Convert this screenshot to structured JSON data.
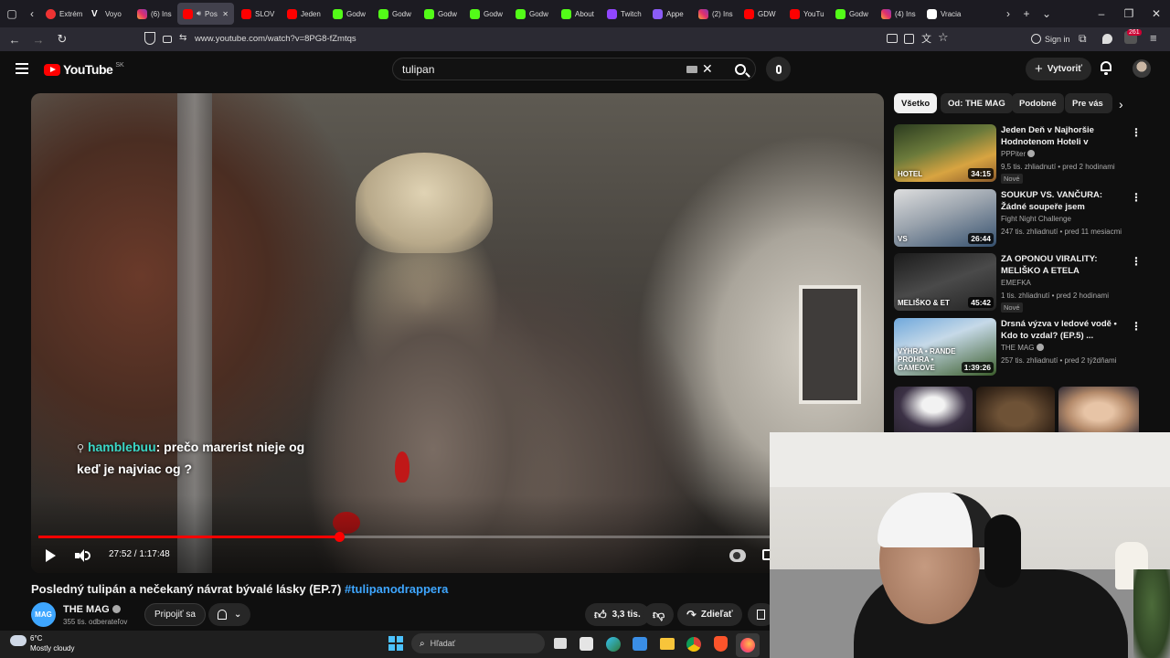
{
  "browser": {
    "tabs": [
      {
        "label": "Extrém",
        "icon": "target-icon"
      },
      {
        "label": "Voyo",
        "icon": "voyo-icon"
      },
      {
        "label": "(6) Ins",
        "icon": "instagram-icon"
      },
      {
        "label": "Pos",
        "icon": "youtube-icon",
        "active": true
      },
      {
        "label": "SLOV",
        "icon": "youtube-icon"
      },
      {
        "label": "Jeden",
        "icon": "youtube-icon"
      },
      {
        "label": "Godw",
        "icon": "kick-icon"
      },
      {
        "label": "Godw",
        "icon": "kick-icon"
      },
      {
        "label": "Godw",
        "icon": "kick-icon"
      },
      {
        "label": "Godw",
        "icon": "kick-icon"
      },
      {
        "label": "Godw",
        "icon": "kick-icon"
      },
      {
        "label": "About",
        "icon": "kick-icon"
      },
      {
        "label": "Twitch",
        "icon": "twitch-icon"
      },
      {
        "label": "Appe",
        "icon": "note-icon"
      },
      {
        "label": "(2) Ins",
        "icon": "instagram-icon"
      },
      {
        "label": "GDW",
        "icon": "youtube-icon"
      },
      {
        "label": "YouTu",
        "icon": "youtube-icon"
      },
      {
        "label": "Godw",
        "icon": "kick-icon"
      },
      {
        "label": "(4) Ins",
        "icon": "instagram-icon"
      },
      {
        "label": "Vracia",
        "icon": "page-icon"
      }
    ],
    "url": "www.youtube.com/watch?v=8PG8-fZmtqs",
    "sign_in": "Sign in",
    "badge": "261"
  },
  "youtube": {
    "logo_text": "YouTube",
    "region": "SK",
    "search_value": "tulipan",
    "create_label": "Vytvoriť"
  },
  "player": {
    "chat_user": "hamblebuu",
    "chat_line1": ": prečo marerist nieje og",
    "chat_line2": "keď je najviac og ?",
    "time_current": "27:52",
    "time_total": "1:17:48",
    "progress_fraction": 0.3585
  },
  "video": {
    "title": "Posledný tulipán a nečekaný návrat bývalé lásky (EP.7)",
    "hashtag": "#tulipanodrappera",
    "channel_avatar": "MAG",
    "channel": "THE MAG",
    "subscribers": "355 tis. odberateľov",
    "join_label": "Pripojiť sa",
    "likes": "3,3 tis.",
    "share_label": "Zdieľať"
  },
  "sidebar": {
    "chips": [
      "Všetko",
      "Od: THE MAG",
      "Podobné",
      "Pre vás"
    ],
    "recommendations": [
      {
        "title": "Jeden Deň v Najhoršie Hodnotenom Hoteli v Kaliforni...",
        "channel": "PPPiter",
        "verified": true,
        "meta": "9,5 tis. zhliadnutí • pred 2 hodinami",
        "badge": "Nové",
        "duration": "34:15",
        "thumb_text": "HOTEL"
      },
      {
        "title": "SOUKUP VS. VANČURA: Žádné soupeře jsem neuplácel ...",
        "channel": "Fight Night Challenge",
        "verified": false,
        "meta": "247 tis. zhliadnutí • pred 11 mesiacmi",
        "badge": "",
        "duration": "26:44",
        "thumb_text": "VS"
      },
      {
        "title": "ZA OPONOU VIRALITY: MELIŠKO A ETELA",
        "channel": "EMEFKA",
        "verified": false,
        "meta": "1 tis. zhliadnutí • pred 2 hodinami",
        "badge": "Nové",
        "duration": "45:42",
        "thumb_text": "MELIŠKO & ET"
      },
      {
        "title": "Drsná výzva v ledové vodě • Kdo to vzdal? (EP.5) ...",
        "channel": "THE MAG",
        "verified": true,
        "meta": "257 tis. zhliadnutí • pred 2 týždňami",
        "badge": "",
        "duration": "1:39:26",
        "thumb_text": "VÝHRA • RANDE PROHRA • GAMEOVE"
      }
    ]
  },
  "taskbar": {
    "temperature": "6°C",
    "weather": "Mostly cloudy",
    "search_placeholder": "Hľadať"
  },
  "colors": {
    "accent": "#ff0000",
    "link": "#3ea6ff",
    "chat_user": "#3ad6c6",
    "bg": "#0f0f0f"
  }
}
